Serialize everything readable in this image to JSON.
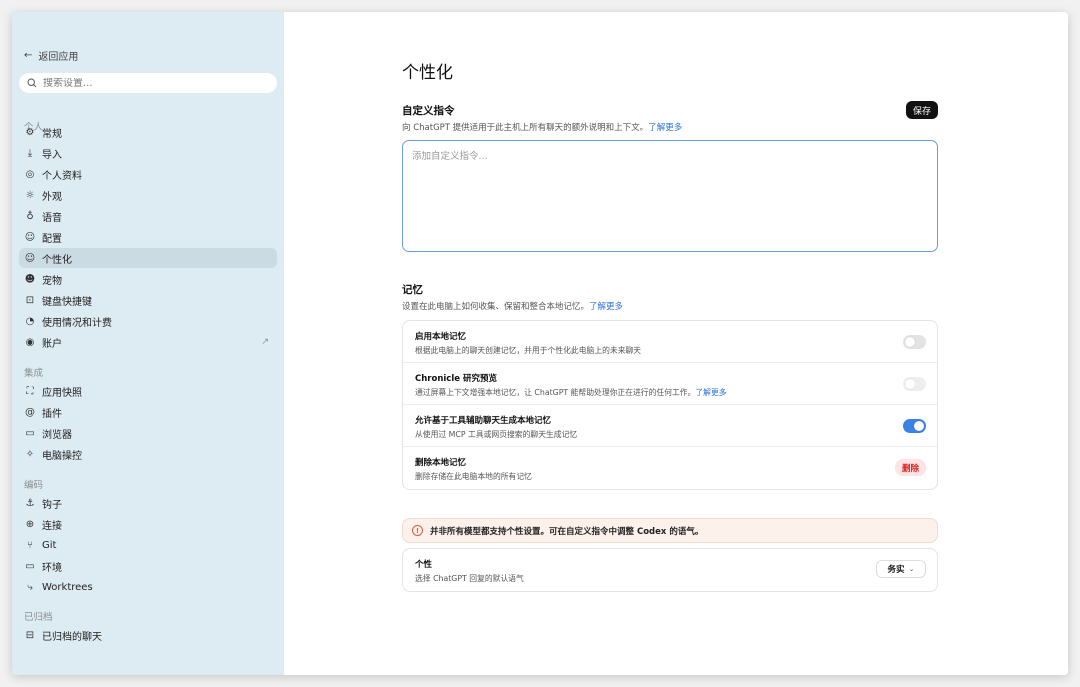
{
  "sidebar": {
    "back_label": "返回应用",
    "search_placeholder": "搜索设置...",
    "sections": {
      "personal": "个人",
      "integrations": "集成",
      "coding": "编码",
      "archived": "已归档"
    },
    "personal_items": [
      {
        "label": "常规",
        "icon": "gear-icon"
      },
      {
        "label": "导入",
        "icon": "import-icon"
      },
      {
        "label": "个人资料",
        "icon": "profile-icon"
      },
      {
        "label": "外观",
        "icon": "sun-icon"
      },
      {
        "label": "语音",
        "icon": "mic-icon"
      },
      {
        "label": "配置",
        "icon": "config-icon"
      },
      {
        "label": "个性化",
        "icon": "smile-icon"
      },
      {
        "label": "宠物",
        "icon": "pet-icon"
      },
      {
        "label": "键盘快捷键",
        "icon": "keyboard-icon"
      },
      {
        "label": "使用情况和计费",
        "icon": "gauge-icon"
      },
      {
        "label": "账户",
        "icon": "account-icon"
      }
    ],
    "integration_items": [
      {
        "label": "应用快照",
        "icon": "snapshot-icon"
      },
      {
        "label": "插件",
        "icon": "at-icon"
      },
      {
        "label": "浏览器",
        "icon": "browser-icon"
      },
      {
        "label": "电脑操控",
        "icon": "sparkle-icon"
      }
    ],
    "coding_items": [
      {
        "label": "钩子",
        "icon": "anchor-icon"
      },
      {
        "label": "连接",
        "icon": "globe-icon"
      },
      {
        "label": "Git",
        "icon": "git-icon"
      },
      {
        "label": "环境",
        "icon": "monitor-icon"
      },
      {
        "label": "Worktrees",
        "icon": "worktree-icon"
      }
    ],
    "archived_items": [
      {
        "label": "已归档的聊天",
        "icon": "archive-icon"
      }
    ],
    "active_item": "个性化"
  },
  "main": {
    "title": "个性化",
    "custom_instructions": {
      "heading": "自定义指令",
      "desc": "向 ChatGPT 提供适用于此主机上所有聊天的额外说明和上下文。",
      "link": "了解更多",
      "save_label": "保存",
      "placeholder": "添加自定义指令..."
    },
    "memory": {
      "heading": "记忆",
      "desc": "设置在此电脑上如何收集、保留和整合本地记忆。",
      "link": "了解更多",
      "rows": [
        {
          "title": "启用本地记忆",
          "desc": "根据此电脑上的聊天创建记忆，并用于个性化此电脑上的未来聊天",
          "state": "off"
        },
        {
          "title": "Chronicle 研究预览",
          "desc": "通过屏幕上下文增强本地记忆，让 ChatGPT 能帮助处理你正在进行的任何工作。",
          "link": "了解更多",
          "state": "off"
        },
        {
          "title": "允许基于工具辅助聊天生成本地记忆",
          "desc": "从使用过 MCP 工具或网页搜索的聊天生成记忆",
          "state": "on"
        },
        {
          "title": "删除本地记忆",
          "desc": "删除存储在此电脑本地的所有记忆",
          "button": "删除"
        }
      ]
    },
    "warning": "并非所有模型都支持个性设置。可在自定义指令中调整 Codex 的语气。",
    "personality": {
      "title": "个性",
      "desc": "选择 ChatGPT 回复的默认语气",
      "value": "务实"
    }
  },
  "colors": {
    "sidebar_bg": "#ddebf2",
    "active_bg": "#cbdbe4",
    "accent": "#3b82e6",
    "link": "#2a73d9",
    "danger": "#d22222"
  }
}
